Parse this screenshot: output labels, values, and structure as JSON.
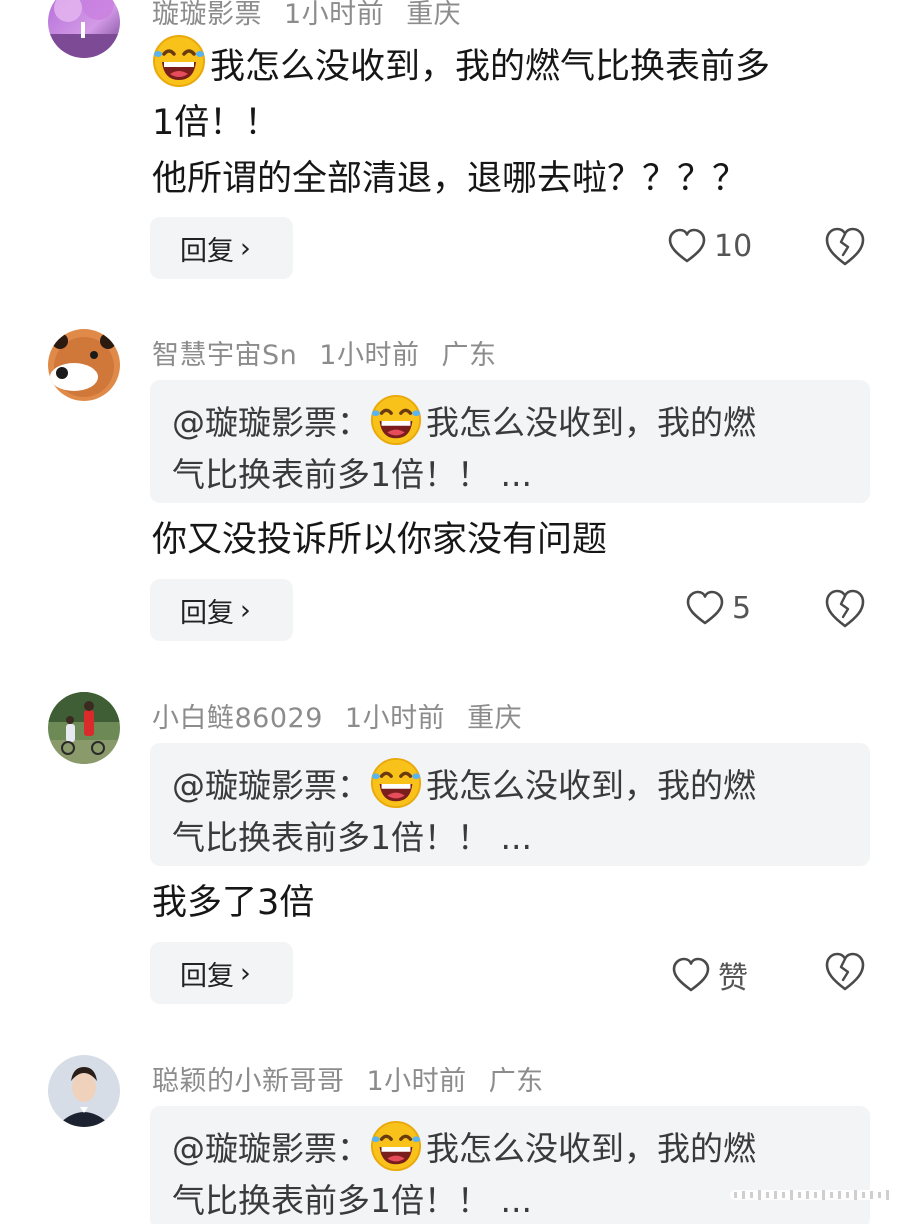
{
  "comments": [
    {
      "username": "璇璇影票",
      "time": "1小时前",
      "location": "重庆",
      "text_line1": "我怎么没收到，我的燃气比换表前多",
      "text_line2": "1倍！！",
      "text_line3": "他所谓的全部清退，退哪去啦？？？？",
      "reply_label": "回复",
      "likes": "10"
    },
    {
      "username": "智慧宇宙Sn",
      "time": "1小时前",
      "location": "广东",
      "quote_line1": "@璇璇影票：",
      "quote_line1b": "我怎么没收到，我的燃",
      "quote_line2": "气比换表前多1倍！！ ...",
      "text": "你又没投诉所以你家没有问题",
      "reply_label": "回复",
      "likes": "5"
    },
    {
      "username": "小白鲢86029",
      "time": "1小时前",
      "location": "重庆",
      "quote_line1": "@璇璇影票：",
      "quote_line1b": "我怎么没收到，我的燃",
      "quote_line2": "气比换表前多1倍！！ ...",
      "text": "我多了3倍",
      "reply_label": "回复",
      "likes": "赞"
    },
    {
      "username": "聪颖的小新哥哥",
      "time": "1小时前",
      "location": "广东",
      "quote_line1": "@璇璇影票：",
      "quote_line1b": "我怎么没收到，我的燃",
      "quote_line2": "气比换表前多1倍！！ ..."
    }
  ],
  "icons": {
    "emoji": "laughing-emoji-icon",
    "like": "heart-outline-icon",
    "dislike": "broken-heart-icon",
    "reply_chevron": "chevron-right-icon"
  },
  "colors": {
    "meta_text": "#8c8c8c",
    "bubble_bg": "#f3f4f6"
  }
}
